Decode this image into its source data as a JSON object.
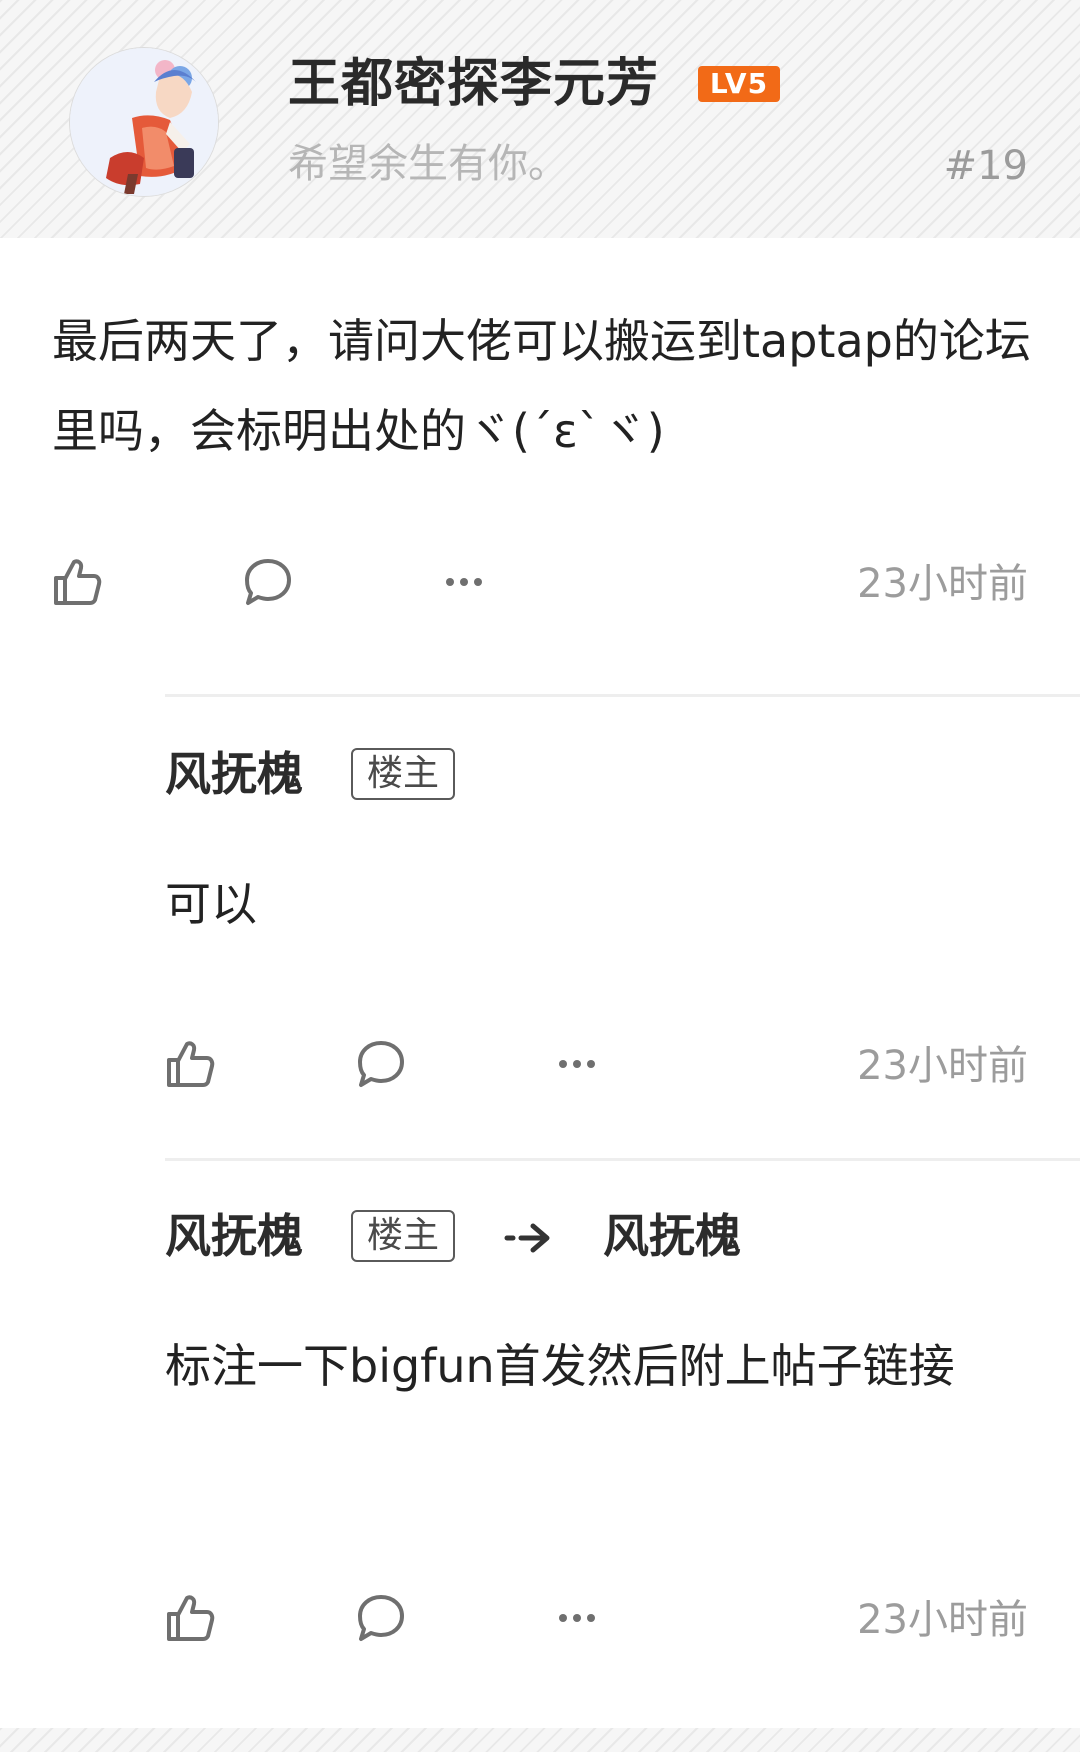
{
  "post": {
    "username": "王都密探李元芳",
    "level_badge": "LV5",
    "signature": "希望余生有你。",
    "floor_number": "#19",
    "content": "最后两天了，请问大佬可以搬运到taptap的论坛里吗，会标明出处的ヾ(´ε`ヾ)",
    "time": "23小时前"
  },
  "replies": [
    {
      "author": "风抚槐",
      "op_tag": "楼主",
      "content": "可以",
      "time": "23小时前"
    },
    {
      "author": "风抚槐",
      "op_tag": "楼主",
      "reply_to": "风抚槐",
      "content": "标注一下bigfun首发然后附上帖子链接",
      "time": "23小时前"
    }
  ],
  "icons": {
    "like": "thumbs-up-icon",
    "comment": "comment-bubble-icon",
    "more": "more-dots-icon",
    "arrow": "reply-arrow-icon"
  },
  "colors": {
    "level_badge": "#f26a17",
    "muted_text": "#9c9c9c",
    "signature": "#b6b6b6",
    "divider": "#eeeeee"
  }
}
